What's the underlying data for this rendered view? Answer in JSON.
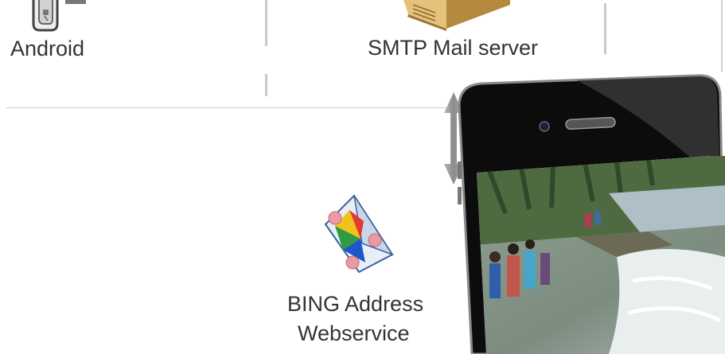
{
  "nodes": {
    "android": {
      "label": "Android",
      "icon": "android-phone-icon"
    },
    "smtp": {
      "label": "SMTP Mail server",
      "icon": "mail-server-icon"
    },
    "bing": {
      "label_line1": "BING Address",
      "label_line2": "Webservice",
      "icon": "webservice-prism-icon"
    }
  },
  "connector": {
    "icon": "double-arrow-icon"
  },
  "phone": {
    "icon": "iphone-device",
    "screen_photo": "flood-scene-photo"
  },
  "colors": {
    "text": "#333333",
    "divider": "#cfcfcf",
    "arrow": "#8f8f8f",
    "server": "#d9b46a"
  }
}
